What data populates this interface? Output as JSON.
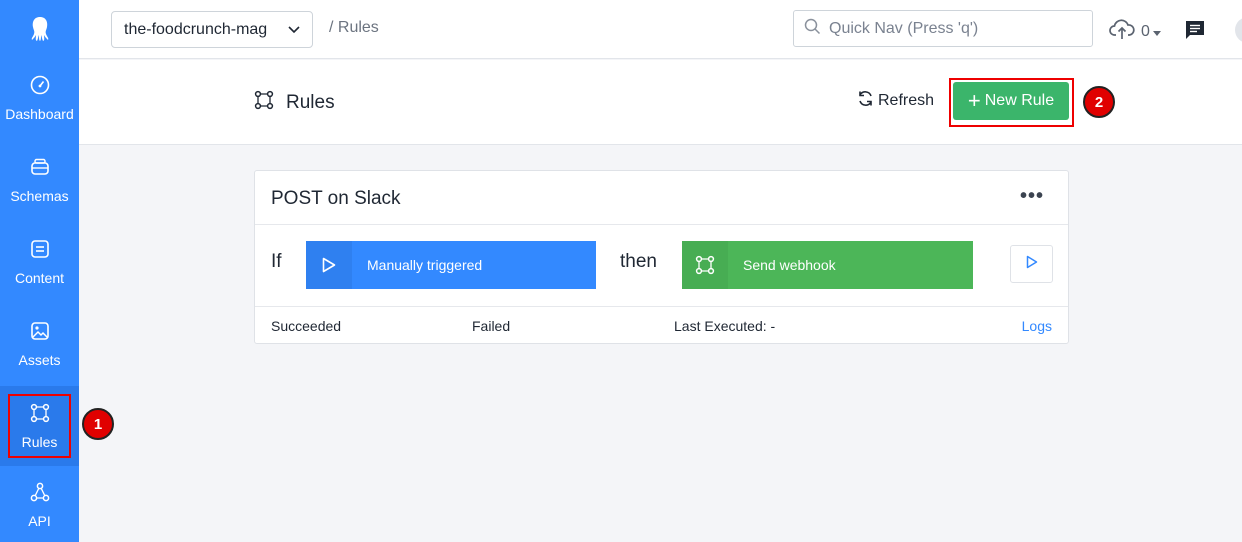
{
  "sidebar": {
    "logo_icon": "squid-logo-icon",
    "items": [
      {
        "label": "Dashboard",
        "icon": "gauge-icon"
      },
      {
        "label": "Schemas",
        "icon": "schemas-icon"
      },
      {
        "label": "Content",
        "icon": "content-icon"
      },
      {
        "label": "Assets",
        "icon": "image-icon"
      },
      {
        "label": "Rules",
        "icon": "rules-icon",
        "active": true
      },
      {
        "label": "API",
        "icon": "api-icon"
      }
    ]
  },
  "topbar": {
    "app_name": "the-foodcrunch-mag",
    "breadcrumb": "/ Rules",
    "quicknav_placeholder": "Quick Nav (Press 'q')",
    "upload_count": "0"
  },
  "header": {
    "title": "Rules",
    "refresh_label": "Refresh",
    "new_rule_label": "New Rule"
  },
  "annotations": {
    "badge_1": "1",
    "badge_2": "2",
    "color": "#e00000"
  },
  "rule": {
    "name": "POST on Slack",
    "if_label": "If",
    "then_label": "then",
    "trigger_label": "Manually triggered",
    "action_label": "Send webhook",
    "succeeded_label": "Succeeded",
    "failed_label": "Failed",
    "last_executed_label": "Last Executed: -",
    "logs_label": "Logs"
  },
  "colors": {
    "brand_blue": "#3389ff",
    "success_green": "#3bb56b",
    "action_green": "#4cb658"
  }
}
